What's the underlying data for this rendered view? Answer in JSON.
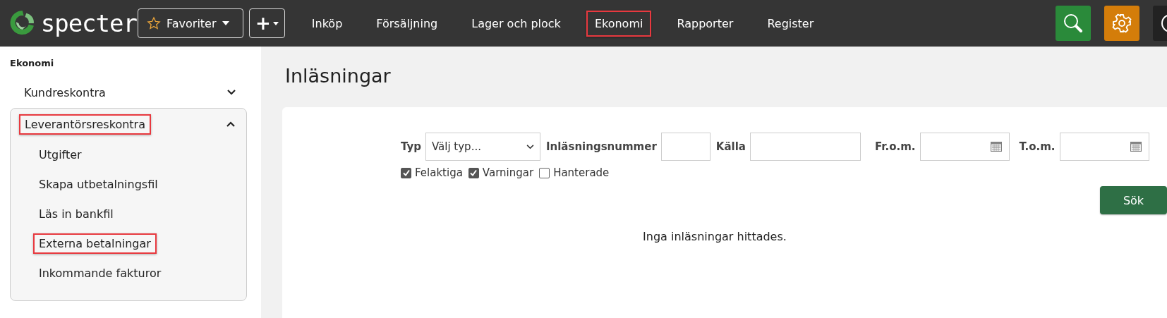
{
  "header": {
    "logo": "specter",
    "favorites": "Favoriter",
    "add_symbol": "+",
    "nav": [
      {
        "label": "Inköp",
        "highlighted": false
      },
      {
        "label": "Försäljning",
        "highlighted": false
      },
      {
        "label": "Lager och plock",
        "highlighted": false
      },
      {
        "label": "Ekonomi",
        "highlighted": true
      },
      {
        "label": "Rapporter",
        "highlighted": false
      },
      {
        "label": "Register",
        "highlighted": false
      }
    ]
  },
  "sidebar": {
    "title": "Ekonomi",
    "items": [
      {
        "label": "Kundreskontra",
        "expanded": false,
        "highlighted": false
      },
      {
        "label": "Leverantörsreskontra",
        "expanded": true,
        "highlighted": true,
        "children": [
          {
            "label": "Utgifter",
            "highlighted": false
          },
          {
            "label": "Skapa utbetalningsfil",
            "highlighted": false
          },
          {
            "label": "Läs in bankfil",
            "highlighted": false
          },
          {
            "label": "Externa betalningar",
            "highlighted": true
          },
          {
            "label": "Inkommande fakturor",
            "highlighted": false
          }
        ]
      }
    ]
  },
  "page": {
    "title": "Inläsningar",
    "filters": [
      {
        "kind": "select",
        "label": "Typ",
        "value": "Välj typ..."
      },
      {
        "kind": "number",
        "label": "Inläsningsnummer"
      },
      {
        "kind": "text",
        "label": "Källa"
      },
      {
        "kind": "date",
        "label": "Fr.o.m."
      },
      {
        "kind": "date",
        "label": "T.o.m."
      }
    ],
    "checkboxes": [
      {
        "label": "Felaktiga",
        "checked": true
      },
      {
        "label": "Varningar",
        "checked": true
      },
      {
        "label": "Hanterade",
        "checked": false
      }
    ],
    "search_button": "Sök",
    "message": "Inga inläsningar hittades."
  }
}
